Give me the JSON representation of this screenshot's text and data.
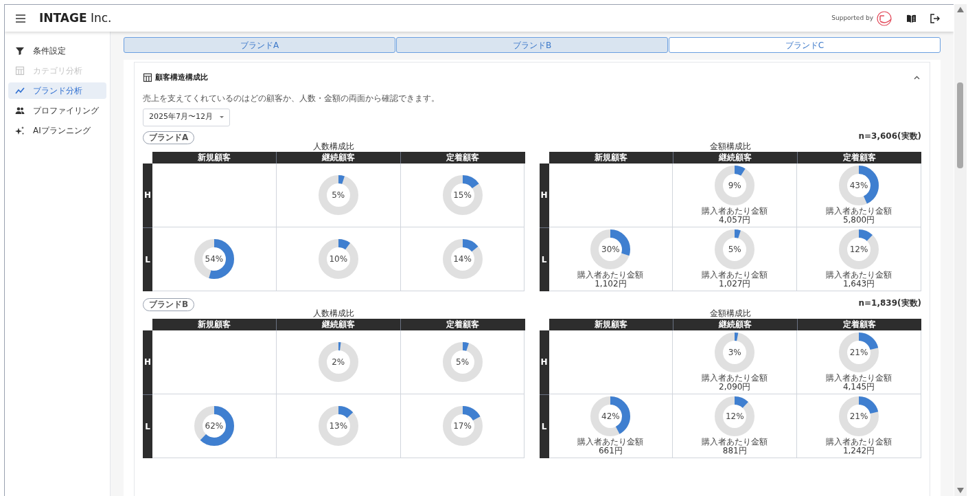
{
  "header": {
    "logo": "**INTAGE** Inc.",
    "supported_by": "Supported by"
  },
  "sidebar": {
    "items": [
      {
        "label": "条件設定",
        "selected": false,
        "disabled": false
      },
      {
        "label": "カテゴリ分析",
        "selected": false,
        "disabled": true
      },
      {
        "label": "ブランド分析",
        "selected": true,
        "disabled": false
      },
      {
        "label": "プロファイリング",
        "selected": false,
        "disabled": false
      },
      {
        "label": "AIプランニング",
        "selected": false,
        "disabled": false
      }
    ]
  },
  "brand_tabs": [
    {
      "label": "ブランドA",
      "selected": true
    },
    {
      "label": "ブランドB",
      "selected": true
    },
    {
      "label": "ブランドC",
      "selected": false
    }
  ],
  "card": {
    "title": "顧客構造構成比",
    "expanded": true,
    "description": "売上を支えてくれているのはどの顧客か、人数・金額の両面から確認できます。",
    "period": "2025年7月〜12月",
    "brands": [
      {
        "label": "ブランドA",
        "n": "n=3,606(実数)",
        "panels": [
          {
            "title": "人数構成比",
            "columns": [
              "新規顧客",
              "継続顧客",
              "定着顧客"
            ],
            "rows": [
              {
                "label": "H",
                "cells": [
                  {
                    "kind": "empty"
                  },
                  {
                    "kind": "donut",
                    "percent": "5%"
                  },
                  {
                    "kind": "donut",
                    "percent": "15%"
                  }
                ]
              },
              {
                "label": "L",
                "cells": [
                  {
                    "kind": "donut",
                    "percent": "54%"
                  },
                  {
                    "kind": "donut",
                    "percent": "10%"
                  },
                  {
                    "kind": "donut",
                    "percent": "14%"
                  }
                ]
              }
            ]
          },
          {
            "title": "金額構成比",
            "columns": [
              "新規顧客",
              "継続顧客",
              "定着顧客"
            ],
            "rows": [
              {
                "label": "H",
                "cells": [
                  {
                    "kind": "empty"
                  },
                  {
                    "kind": "donut",
                    "percent": "9%",
                    "caption": "購入者あたり金額",
                    "amount": "4,057円"
                  },
                  {
                    "kind": "donut",
                    "percent": "43%",
                    "caption": "購入者あたり金額",
                    "amount": "5,800円"
                  }
                ]
              },
              {
                "label": "L",
                "cells": [
                  {
                    "kind": "donut",
                    "percent": "30%",
                    "caption": "購入者あたり金額",
                    "amount": "1,102円"
                  },
                  {
                    "kind": "donut",
                    "percent": "5%",
                    "caption": "購入者あたり金額",
                    "amount": "1,027円"
                  },
                  {
                    "kind": "donut",
                    "percent": "12%",
                    "caption": "購入者あたり金額",
                    "amount": "1,643円"
                  }
                ]
              }
            ]
          }
        ]
      },
      {
        "label": "ブランドB",
        "n": "n=1,839(実数)",
        "panels": [
          {
            "title": "人数構成比",
            "columns": [
              "新規顧客",
              "継続顧客",
              "定着顧客"
            ],
            "rows": [
              {
                "label": "H",
                "cells": [
                  {
                    "kind": "empty"
                  },
                  {
                    "kind": "donut",
                    "percent": "2%"
                  },
                  {
                    "kind": "donut",
                    "percent": "5%"
                  }
                ]
              },
              {
                "label": "L",
                "cells": [
                  {
                    "kind": "donut",
                    "percent": "62%"
                  },
                  {
                    "kind": "donut",
                    "percent": "13%"
                  },
                  {
                    "kind": "donut",
                    "percent": "17%"
                  }
                ]
              }
            ]
          },
          {
            "title": "金額構成比",
            "columns": [
              "新規顧客",
              "継続顧客",
              "定着顧客"
            ],
            "rows": [
              {
                "label": "H",
                "cells": [
                  {
                    "kind": "empty"
                  },
                  {
                    "kind": "donut",
                    "percent": "3%",
                    "caption": "購入者あたり金額",
                    "amount": "2,090円"
                  },
                  {
                    "kind": "donut",
                    "percent": "21%",
                    "caption": "購入者あたり金額",
                    "amount": "4,145円"
                  }
                ]
              },
              {
                "label": "L",
                "cells": [
                  {
                    "kind": "donut",
                    "percent": "42%",
                    "caption": "購入者あたり金額",
                    "amount": "661円"
                  },
                  {
                    "kind": "donut",
                    "percent": "12%",
                    "caption": "購入者あたり金額",
                    "amount": "881円"
                  },
                  {
                    "kind": "donut",
                    "percent": "21%",
                    "caption": "購入者あたり金額",
                    "amount": "1,242円"
                  }
                ]
              }
            ]
          }
        ]
      }
    ]
  }
}
